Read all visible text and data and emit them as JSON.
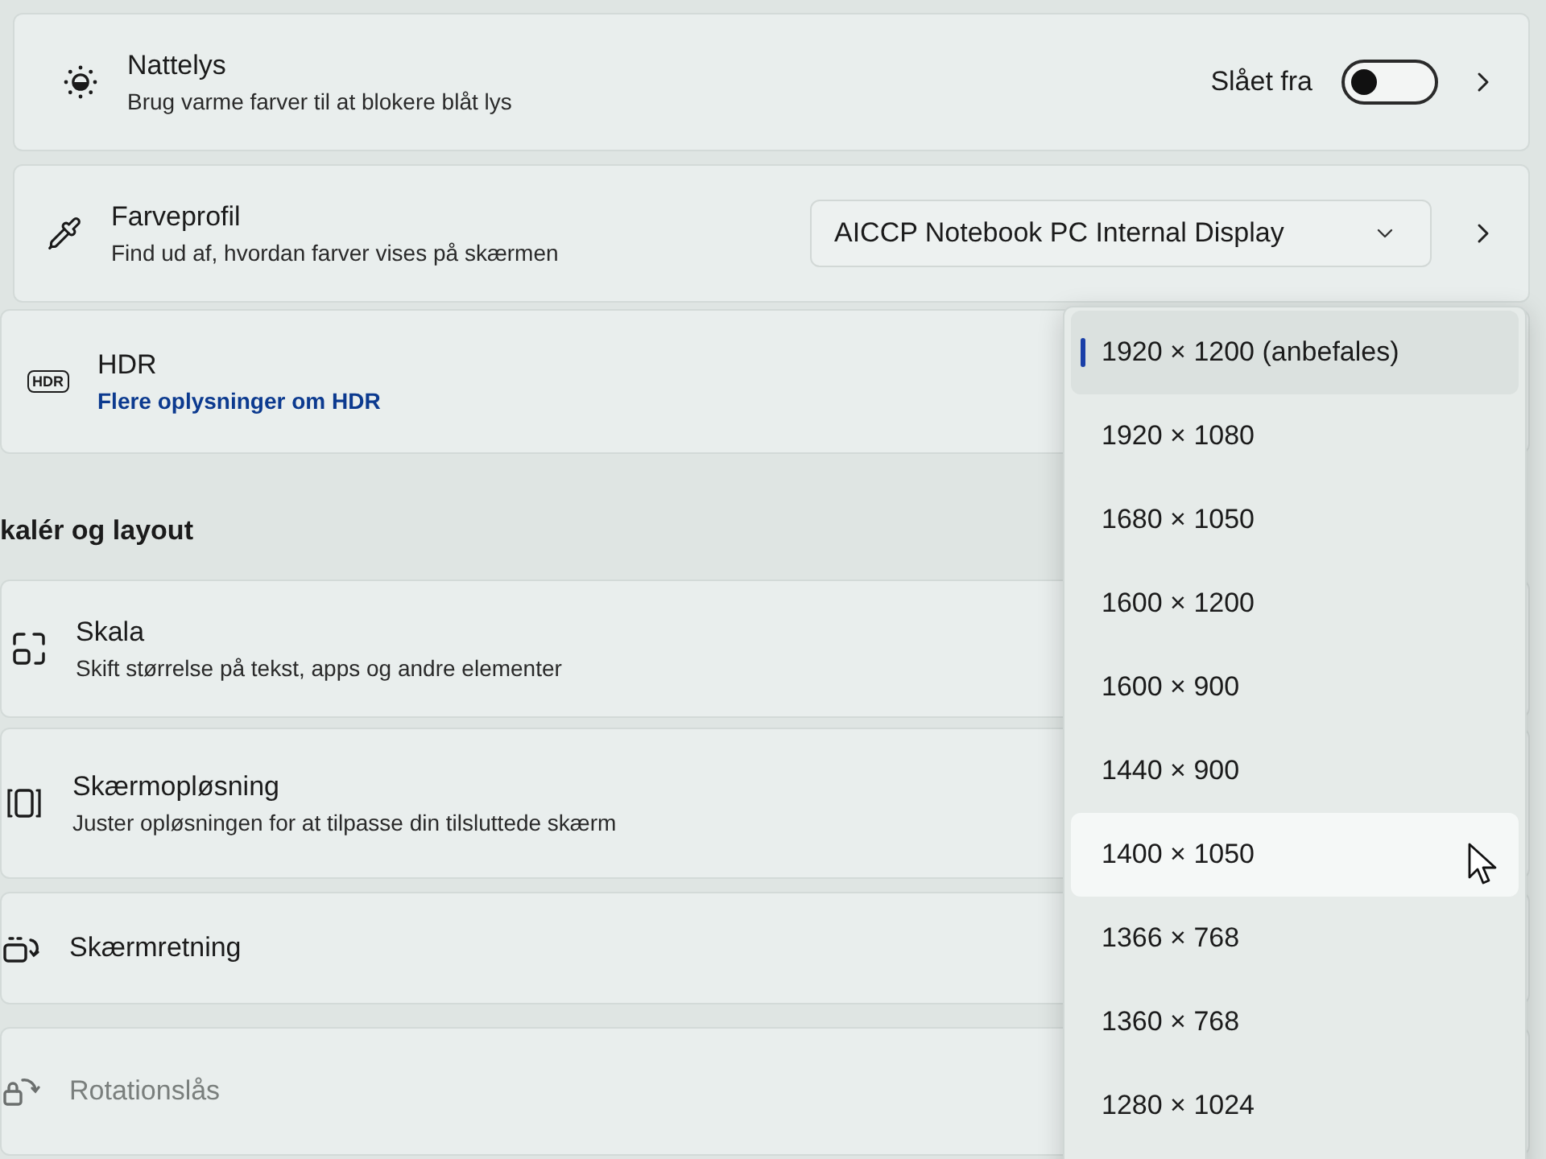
{
  "settings_sections": [
    {
      "rows": [
        {
          "kind": "toggle",
          "title": "Nattelys",
          "description": "Brug varme farver til at blokere blåt lys",
          "status": "Slået fra",
          "on": false,
          "disabled": false
        },
        {
          "kind": "select",
          "title": "Farveprofil",
          "description": "Find ud af, hvordan farver vises på skærmen",
          "value": "AICCP Notebook PC Internal Display",
          "disabled": false
        },
        {
          "kind": "link",
          "icon_label": "HDR",
          "title": "HDR",
          "link": "Flere oplysninger om HDR",
          "disabled": false
        }
      ]
    },
    {
      "heading": "kalér og layout",
      "rows": [
        {
          "kind": "plain",
          "title": "Skala",
          "description": "Skift størrelse på tekst, apps og andre elementer",
          "disabled": false
        },
        {
          "kind": "plain",
          "title": "Skærmopløsning",
          "description": "Juster opløsningen for at tilpasse din tilsluttede skærm",
          "disabled": false
        },
        {
          "kind": "plain",
          "title": "Skærmretning",
          "disabled": false
        },
        {
          "kind": "plain",
          "title": "Rotationslås",
          "disabled": true
        }
      ]
    }
  ],
  "resolution_menu": {
    "options": [
      {
        "label": "1920 × 1200 (anbefales)",
        "selected": true,
        "hovered": false
      },
      {
        "label": "1920 × 1080",
        "selected": false,
        "hovered": false
      },
      {
        "label": "1680 × 1050",
        "selected": false,
        "hovered": false
      },
      {
        "label": "1600 × 1200",
        "selected": false,
        "hovered": false
      },
      {
        "label": "1600 × 900",
        "selected": false,
        "hovered": false
      },
      {
        "label": "1440 × 900",
        "selected": false,
        "hovered": false
      },
      {
        "label": "1400 × 1050",
        "selected": false,
        "hovered": true
      },
      {
        "label": "1366 × 768",
        "selected": false,
        "hovered": false
      },
      {
        "label": "1360 × 768",
        "selected": false,
        "hovered": false
      },
      {
        "label": "1280 × 1024",
        "selected": false,
        "hovered": false
      }
    ]
  }
}
